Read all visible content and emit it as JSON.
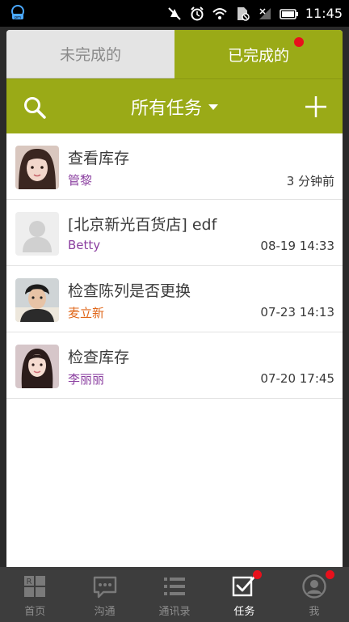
{
  "status_bar": {
    "time": "11:45",
    "icons": [
      "app-notification-icon",
      "mute-icon",
      "alarm-icon",
      "wifi-icon",
      "no-sim-icon",
      "signal-icon",
      "battery-icon"
    ]
  },
  "tabs": [
    {
      "label": "未完成的",
      "selected": false
    },
    {
      "label": "已完成的",
      "selected": true,
      "has_badge": true
    }
  ],
  "toolbar": {
    "filter_label": "所有任务",
    "search_icon": "search-icon",
    "add_icon": "plus-icon"
  },
  "tasks": [
    {
      "title": "查看库存",
      "assignee": "管黎",
      "assignee_color": "#8b3fa0",
      "time": "3 分钟前",
      "avatar": "photo-avatar"
    },
    {
      "title": "[北京新光百货店] edf",
      "assignee": "Betty",
      "assignee_color": "#8b3fa0",
      "time": "08-19 14:33",
      "avatar": "default-avatar"
    },
    {
      "title": "检查陈列是否更换",
      "assignee": "麦立新",
      "assignee_color": "#e0671a",
      "time": "07-23 14:13",
      "avatar": "photo-avatar"
    },
    {
      "title": "检查库存",
      "assignee": "李丽丽",
      "assignee_color": "#8b3fa0",
      "time": "07-20 17:45",
      "avatar": "photo-avatar"
    }
  ],
  "nav": [
    {
      "label": "首页",
      "icon": "home-icon",
      "active": false,
      "badge": false
    },
    {
      "label": "沟通",
      "icon": "chat-icon",
      "active": false,
      "badge": false
    },
    {
      "label": "通讯录",
      "icon": "contacts-icon",
      "active": false,
      "badge": false
    },
    {
      "label": "任务",
      "icon": "task-check-icon",
      "active": true,
      "badge": true
    },
    {
      "label": "我",
      "icon": "profile-icon",
      "active": false,
      "badge": true
    }
  ],
  "colors": {
    "accent": "#9aaa17",
    "badge": "#e8101c",
    "nav_bg": "#3d3d3d"
  }
}
